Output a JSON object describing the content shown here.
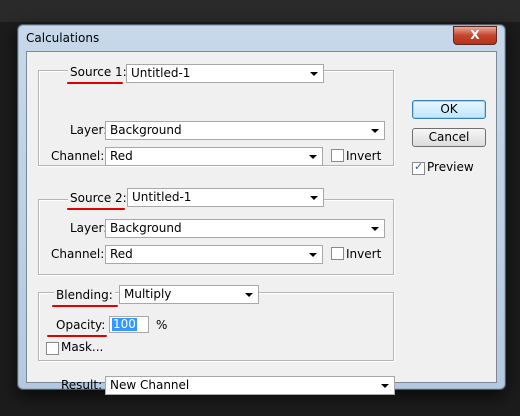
{
  "window": {
    "title": "Calculations",
    "close_label": "X"
  },
  "source1": {
    "label": "Source 1:",
    "source_value": "Untitled-1",
    "layer_label": "Layer:",
    "layer_value": "Background",
    "channel_label": "Channel:",
    "channel_value": "Red",
    "invert_label": "Invert",
    "invert_checked": false
  },
  "source2": {
    "label": "Source 2:",
    "source_value": "Untitled-1",
    "layer_label": "Layer:",
    "layer_value": "Background",
    "channel_label": "Channel:",
    "channel_value": "Red",
    "invert_label": "Invert",
    "invert_checked": false
  },
  "blending": {
    "label": "Blending:",
    "mode_value": "Multiply",
    "opacity_label": "Opacity:",
    "opacity_value": "100",
    "opacity_unit": "%",
    "mask_label": "Mask...",
    "mask_checked": false
  },
  "result": {
    "label": "Result:",
    "value": "New Channel"
  },
  "buttons": {
    "ok_label": "OK",
    "cancel_label": "Cancel"
  },
  "preview": {
    "label": "Preview",
    "checked": true
  },
  "colors": {
    "annotation_red": "#e00000",
    "selection_blue": "#3399ff"
  }
}
